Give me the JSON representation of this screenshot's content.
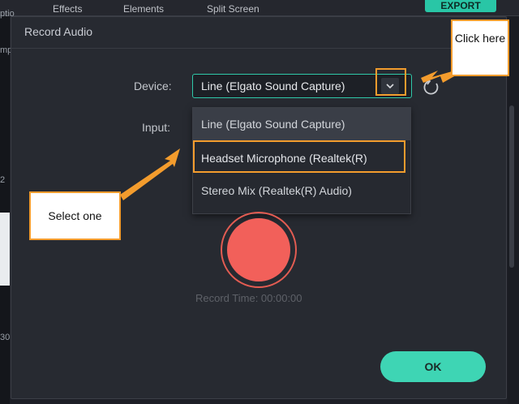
{
  "app": {
    "menu": [
      "Effects",
      "Elements",
      "Split Screen"
    ],
    "export_label": "EXPORT",
    "left_clips": [
      "ptio",
      "mp",
      "2",
      "30"
    ]
  },
  "dialog": {
    "title": "Record Audio",
    "device_label": "Device:",
    "device_value": "Line (Elgato Sound Capture)",
    "input_label": "Input:",
    "dropdown_options": [
      "Line (Elgato Sound Capture)",
      "Headset Microphone (Realtek(R)",
      "Stereo Mix (Realtek(R) Audio)"
    ],
    "record_time": "Record Time: 00:00:00",
    "ok_label": "OK"
  },
  "annotations": {
    "click_here": "Click here",
    "select_one": "Select one"
  },
  "colors": {
    "accent": "#3ed5b4",
    "record": "#f2605a",
    "annotation": "#f39c2d"
  },
  "icons": {
    "dropdown": "chevron-down-icon",
    "refresh": "refresh-icon",
    "record": "record-button-icon"
  }
}
